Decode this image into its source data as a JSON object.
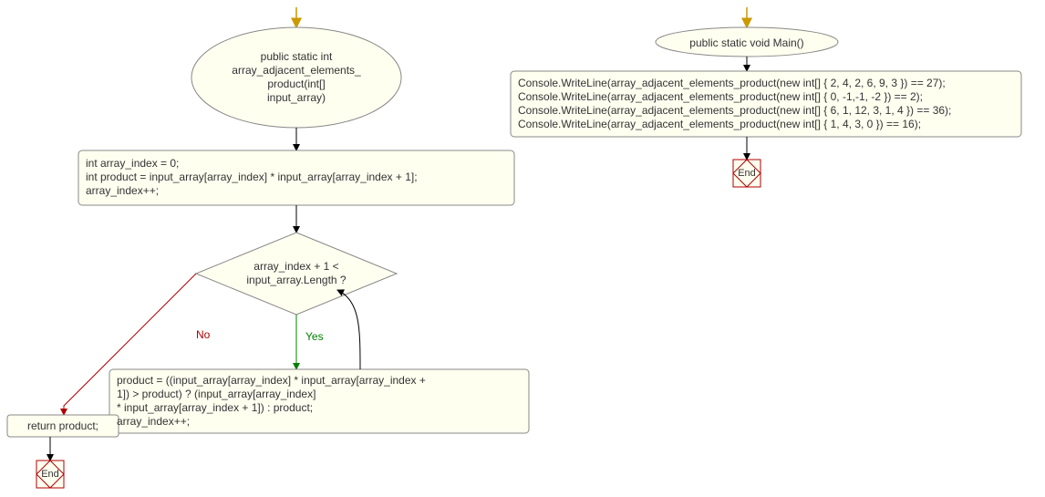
{
  "left": {
    "start_arrow": true,
    "func_sig": "public static int\narray_adjacent_elements_\nproduct(int[]\ninput_array)",
    "init_block": "int array_index = 0;\nint product = input_array[array_index] * input_array[array_index + 1];\narray_index++;",
    "cond": "array_index + 1 <\ninput_array.Length ?",
    "yes_label": "Yes",
    "no_label": "No",
    "loop_body": "product = ((input_array[array_index] * input_array[array_index +\n1]) > product) ? (input_array[array_index]\n* input_array[array_index + 1]) : product;\narray_index++;",
    "return_text": "return product;",
    "end_label": "End"
  },
  "right": {
    "start_arrow": true,
    "func_sig": "public static void Main()",
    "body": "Console.WriteLine(array_adjacent_elements_product(new int[] { 2, 4, 2, 6, 9, 3 }) == 27);\nConsole.WriteLine(array_adjacent_elements_product(new int[] { 0, -1,-1, -2 }) == 2);\nConsole.WriteLine(array_adjacent_elements_product(new int[] { 6, 1, 12, 3, 1, 4 }) == 36);\nConsole.WriteLine(array_adjacent_elements_product(new int[] { 1, 4, 3, 0 }) == 16);",
    "end_label": "End"
  },
  "colors": {
    "outline": "#888888",
    "fill": "#fffff0",
    "end_stroke": "#b00000",
    "arrow_in": "#cc9900",
    "yes": "#008000",
    "no": "#b00000"
  }
}
